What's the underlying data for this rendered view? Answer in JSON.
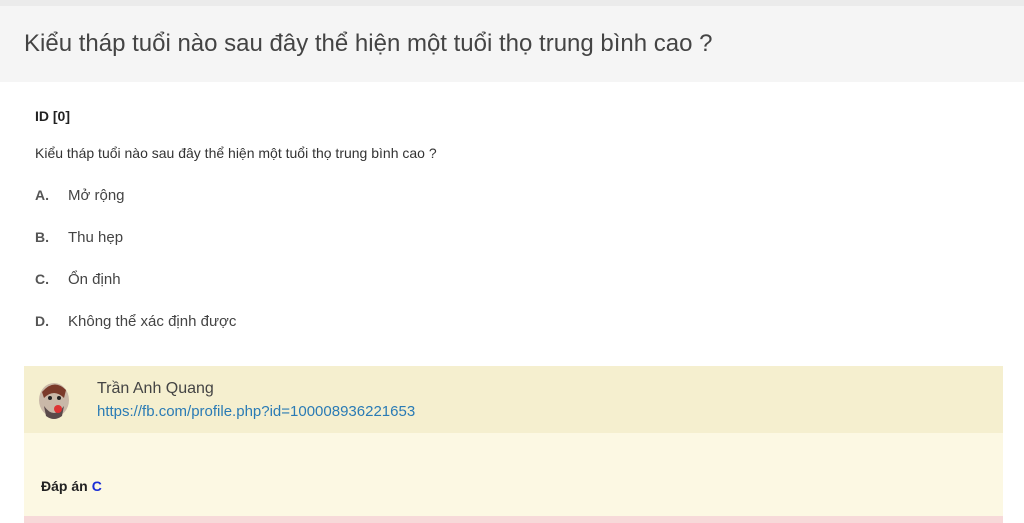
{
  "header": {
    "title": "Kiểu tháp tuổi nào sau đây thể hiện một tuổi thọ trung bình cao ?"
  },
  "question": {
    "id_label": "ID [0]",
    "text": "Kiểu tháp tuổi nào sau đây thể hiện một tuổi thọ trung bình cao ?",
    "options": [
      {
        "letter": "A.",
        "text": "Mở rộng"
      },
      {
        "letter": "B.",
        "text": "Thu hẹp"
      },
      {
        "letter": "C.",
        "text": "Ổn định"
      },
      {
        "letter": "D.",
        "text": "Không thể xác định được"
      }
    ]
  },
  "answer": {
    "author_name": "Trần Anh Quang",
    "author_link": "https://fb.com/profile.php?id=100008936221653",
    "label": "Đáp án",
    "letter": "C"
  },
  "colors": {
    "header_bg": "#f5f5f5",
    "answer_bg": "#fcf8e3",
    "answer_head_bg": "#f5efcf",
    "link": "#2a7bb5",
    "answer_letter": "#1a2ed6"
  }
}
